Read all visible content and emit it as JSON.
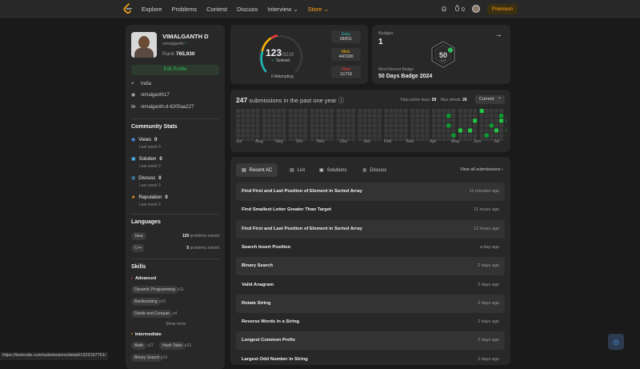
{
  "nav": {
    "links": [
      "Explore",
      "Problems",
      "Contest",
      "Discuss",
      "Interview",
      "Store"
    ],
    "notif_count": "0",
    "premium": "Premium"
  },
  "profile": {
    "name": "VIMALGANTH D",
    "handle": "vimalganth",
    "rank_label": "Rank",
    "rank_value": "765,930",
    "edit_label": "Edit Profile",
    "location": "India",
    "github": "vimalganth17",
    "linkedin": "vimalganth-d-6205aa227"
  },
  "community": {
    "title": "Community Stats",
    "items": [
      {
        "label": "Views",
        "value": "0",
        "last": "Last week",
        "lastv": "0"
      },
      {
        "label": "Solution",
        "value": "0",
        "last": "Last week",
        "lastv": "0"
      },
      {
        "label": "Discuss",
        "value": "0",
        "last": "Last week",
        "lastv": "0"
      },
      {
        "label": "Reputation",
        "value": "0",
        "last": "Last week",
        "lastv": "0"
      }
    ]
  },
  "languages": {
    "title": "Languages",
    "items": [
      {
        "name": "Java",
        "count": "120",
        "suffix": "problems solved"
      },
      {
        "name": "C++",
        "count": "5",
        "suffix": "problems solved"
      }
    ]
  },
  "skills": {
    "title": "Skills",
    "advanced": "Advanced",
    "adv_items": [
      {
        "name": "Dynamic Programming",
        "count": "x11"
      },
      {
        "name": "Backtracking",
        "count": "x10"
      },
      {
        "name": "Divide and Conquer",
        "count": "x4"
      }
    ],
    "show_more": "Show more",
    "intermediate": "Intermediate",
    "int_items": [
      {
        "name": "Math",
        "count": "x27"
      },
      {
        "name": "Hash Table",
        "count": "x23"
      },
      {
        "name": "Binary Search",
        "count": "x19"
      }
    ]
  },
  "solved": {
    "count": "123",
    "total": "/3219",
    "label": "Solved",
    "attempting_count": "0",
    "attempting": "Attempting",
    "easy_label": "Easy",
    "easy_val": "68/811",
    "easy_color": "#1cbaba",
    "med_label": "Med.",
    "med_val": "44/1680",
    "med_color": "#ffb700",
    "hard_label": "Hard",
    "hard_val": "11/718",
    "hard_color": "#f63737"
  },
  "badges": {
    "label": "Badges",
    "count": "1",
    "recent_label": "Most Recent Badge",
    "recent": "50 Days Badge 2024",
    "badge_text": "2024"
  },
  "heatmap": {
    "count": "247",
    "title": "submissions in the past one year",
    "active_label": "Total active days:",
    "active_value": "59",
    "streak_label": "Max streak:",
    "streak_value": "26",
    "selector": "Current",
    "months": [
      "Jul",
      "Aug",
      "Sep",
      "Oct",
      "Nov",
      "Dec",
      "Jan",
      "Feb",
      "Mar",
      "Apr",
      "May",
      "Jun",
      "Jul"
    ]
  },
  "recent": {
    "tabs": [
      "Recent AC",
      "List",
      "Solutions",
      "Discuss"
    ],
    "view_all": "View all submissions",
    "rows": [
      {
        "title": "Find First and Last Position of Element in Sorted Array",
        "ago": "11 minutes ago"
      },
      {
        "title": "Find Smallest Letter Greater Than Target",
        "ago": "11 hours ago"
      },
      {
        "title": "Find First and Last Position of Element in Sorted Array",
        "ago": "12 hours ago"
      },
      {
        "title": "Search Insert Position",
        "ago": "a day ago"
      },
      {
        "title": "Binary Search",
        "ago": "2 days ago"
      },
      {
        "title": "Valid Anagram",
        "ago": "2 days ago"
      },
      {
        "title": "Rotate String",
        "ago": "2 days ago"
      },
      {
        "title": "Reverse Words in a String",
        "ago": "2 days ago"
      },
      {
        "title": "Longest Common Prefix",
        "ago": "2 days ago"
      },
      {
        "title": "Largest Odd Number in String",
        "ago": "2 days ago"
      }
    ]
  },
  "statusbar": "https://leetcode.com/submissions/detail/1323197761/",
  "colors": {
    "accent": "#ffa116",
    "green": "#2cbb5d",
    "card": "#282828"
  }
}
